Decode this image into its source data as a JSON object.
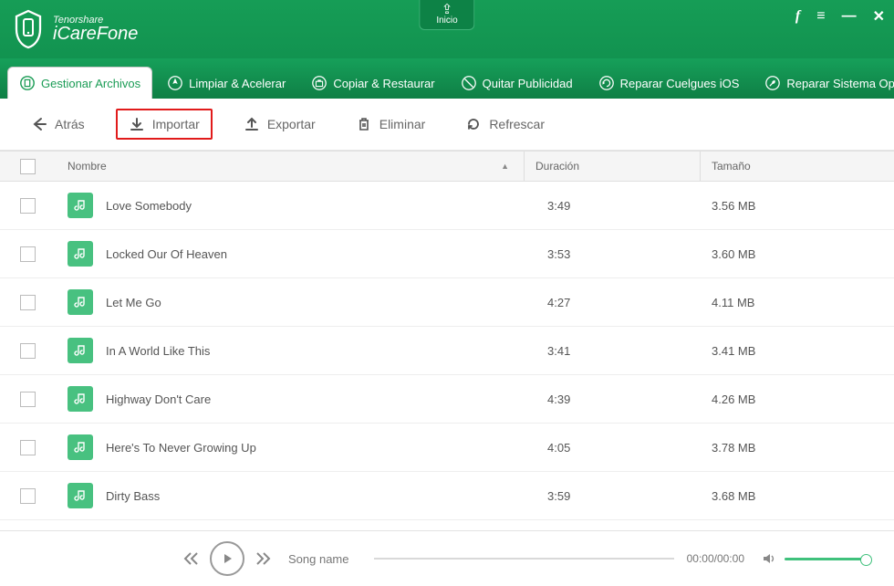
{
  "brand": {
    "company": "Tenorshare",
    "product": "iCareFone"
  },
  "titlebar": {
    "home_label": "Inicio"
  },
  "tabs": [
    {
      "label": "Gestionar Archivos",
      "active": true
    },
    {
      "label": "Limpiar & Acelerar"
    },
    {
      "label": "Copiar  & Restaurar"
    },
    {
      "label": "Quitar Publicidad"
    },
    {
      "label": "Reparar Cuelgues iOS"
    },
    {
      "label": "Reparar Sistema Operativo"
    }
  ],
  "toolbar": {
    "back": "Atrás",
    "import": "Importar",
    "export": "Exportar",
    "delete": "Eliminar",
    "refresh": "Refrescar"
  },
  "columns": {
    "name": "Nombre",
    "duration": "Duración",
    "size": "Tamaño"
  },
  "rows": [
    {
      "name": "Love Somebody",
      "duration": "3:49",
      "size": "3.56 MB"
    },
    {
      "name": "Locked Our Of Heaven",
      "duration": "3:53",
      "size": "3.60 MB"
    },
    {
      "name": "Let Me Go",
      "duration": "4:27",
      "size": "4.11 MB"
    },
    {
      "name": "In A World Like This",
      "duration": "3:41",
      "size": "3.41 MB"
    },
    {
      "name": "Highway Don't Care",
      "duration": "4:39",
      "size": "4.26 MB"
    },
    {
      "name": "Here's To Never Growing Up",
      "duration": "4:05",
      "size": "3.78 MB"
    },
    {
      "name": "Dirty Bass",
      "duration": "3:59",
      "size": "3.68 MB"
    }
  ],
  "player": {
    "song": "Song name",
    "time": "00:00/00:00"
  }
}
